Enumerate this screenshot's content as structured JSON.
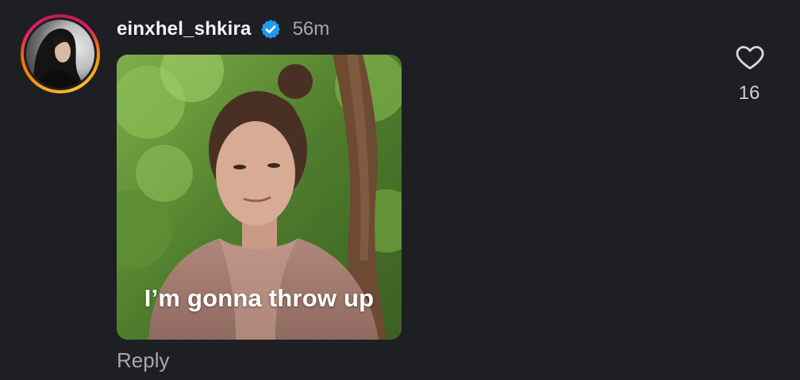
{
  "comment": {
    "username": "einxhel_shkira",
    "verified_icon": "verified-badge-icon",
    "timestamp": "56m",
    "gif_caption": "I’m gonna throw up",
    "reply_label": "Reply",
    "like_icon": "heart-outline-icon",
    "like_count": "16"
  },
  "colors": {
    "background": "#1e1f22",
    "verified_blue": "#1d9bf0",
    "muted_text": "#a8a8a8"
  }
}
